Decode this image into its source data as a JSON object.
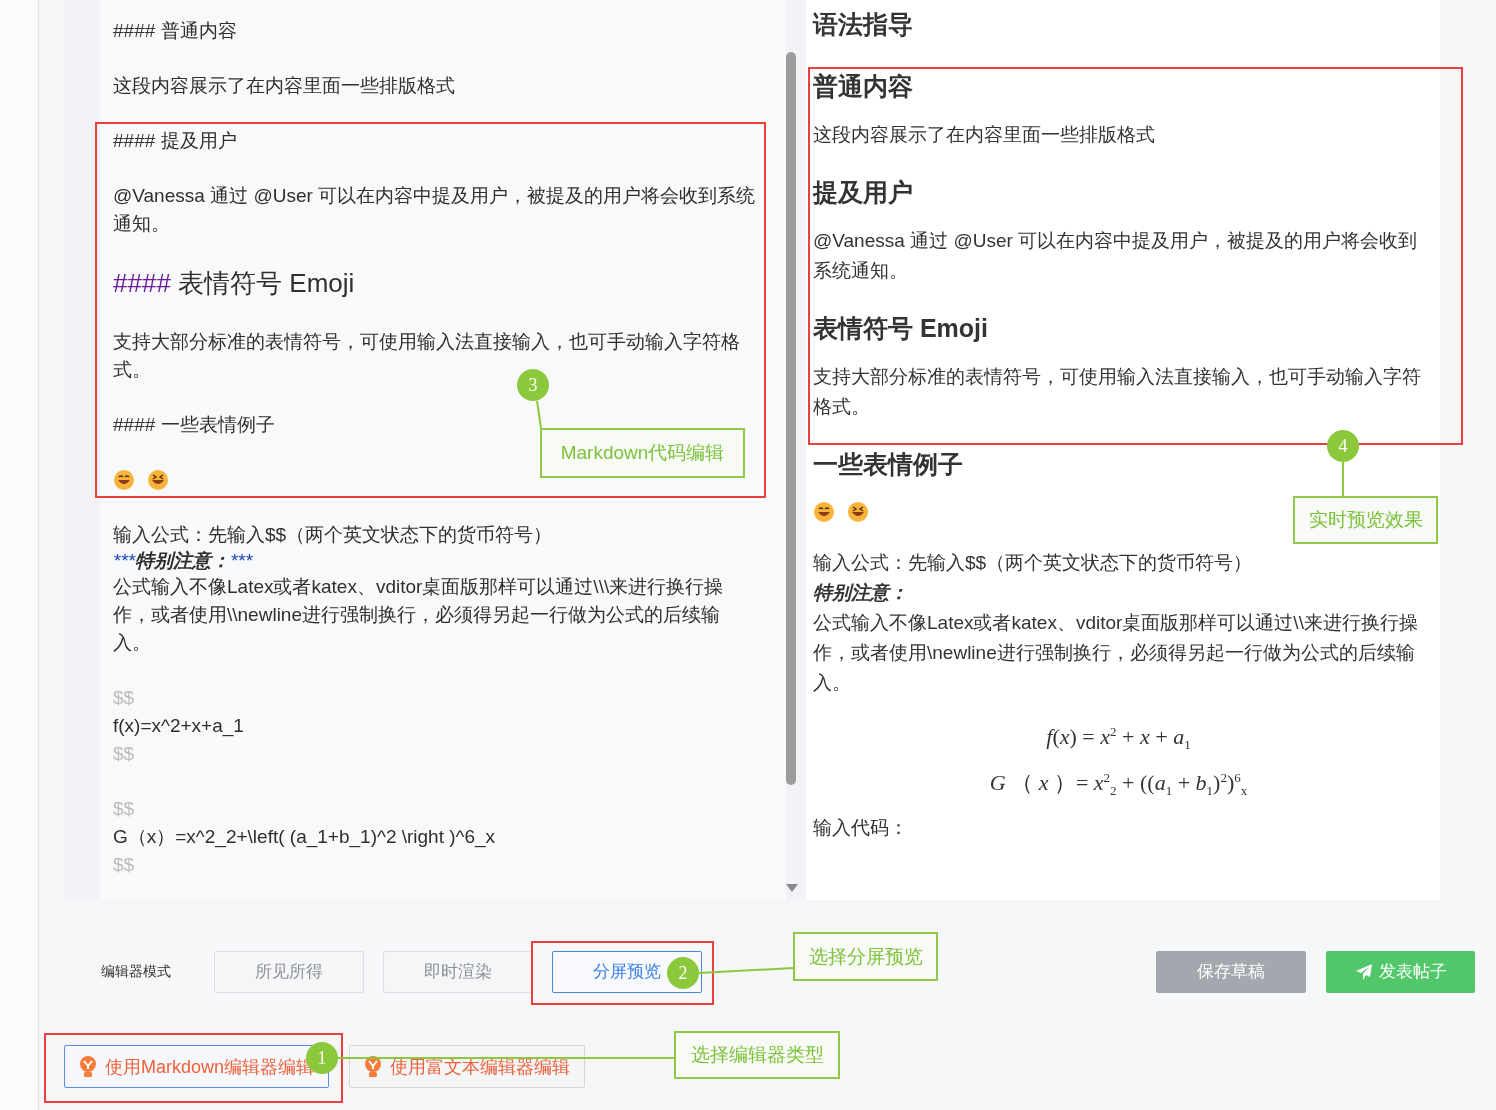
{
  "editor": {
    "lines": [
      {
        "kind": "heading",
        "marker": "####",
        "text": "普通内容"
      },
      {
        "kind": "blank"
      },
      {
        "kind": "text",
        "text": "这段内容展示了在内容里面一些排版格式"
      },
      {
        "kind": "blank"
      },
      {
        "kind": "heading",
        "marker": "####",
        "text": "提及用户"
      },
      {
        "kind": "blank"
      },
      {
        "kind": "text",
        "text": "@Vanessa 通过 @User 可以在内容中提及用户，被提及的用户将会收到系统通知。"
      },
      {
        "kind": "blank"
      },
      {
        "kind": "big-heading",
        "marker": "####",
        "text": "表情符号 Emoji"
      },
      {
        "kind": "blank"
      },
      {
        "kind": "text",
        "text": "支持大部分标准的表情符号，可使用输入法直接输入，也可手动输入字符格式。"
      },
      {
        "kind": "blank"
      },
      {
        "kind": "heading",
        "marker": "####",
        "text": "一些表情例子"
      },
      {
        "kind": "blank"
      },
      {
        "kind": "emoji"
      },
      {
        "kind": "blank"
      },
      {
        "kind": "text",
        "text": "输入公式：先输入$$（两个英文状态下的货币符号）"
      },
      {
        "kind": "note",
        "marker": "***",
        "text": "特别注意：",
        "end": "***"
      },
      {
        "kind": "text",
        "text": "公式输入不像Latex或者katex、vditor桌面版那样可以通过\\\\\\来进行换行操作，或者使用\\\\newline进行强制换行，必须得另起一行做为公式的后续输入。"
      },
      {
        "kind": "blank"
      },
      {
        "kind": "delim",
        "text": "$$"
      },
      {
        "kind": "text",
        "text": "f(x)=x^2+x+a_1"
      },
      {
        "kind": "delim",
        "text": "$$"
      },
      {
        "kind": "blank"
      },
      {
        "kind": "delim",
        "text": "$$"
      },
      {
        "kind": "text",
        "text": "G（x）=x^2_2+\\left( (a_1+b_1)^2  \\right )^6_x"
      },
      {
        "kind": "delim",
        "text": "$$"
      }
    ]
  },
  "preview": {
    "title": "语法指导",
    "blocks": [
      {
        "kind": "heading",
        "text": "普通内容"
      },
      {
        "kind": "text",
        "text": "这段内容展示了在内容里面一些排版格式"
      },
      {
        "kind": "heading",
        "text": "提及用户"
      },
      {
        "kind": "text",
        "text": "@Vanessa 通过 @User 可以在内容中提及用户，被提及的用户将会收到系统通知。"
      },
      {
        "kind": "heading",
        "text": "表情符号 Emoji"
      },
      {
        "kind": "text",
        "text": "支持大部分标准的表情符号，可使用输入法直接输入，也可手动输入字符格式。"
      },
      {
        "kind": "heading",
        "text": "一些表情例子"
      },
      {
        "kind": "emoji"
      },
      {
        "kind": "tight",
        "text": "输入公式：先输入$$（两个英文状态下的货币符号）"
      },
      {
        "kind": "note",
        "text": "特别注意："
      },
      {
        "kind": "text",
        "text": "公式输入不像Latex或者katex、vditor桌面版那样可以通过\\\\来进行换行操作，或者使用\\newline进行强制换行，必须得另起一行做为公式的后续输入。"
      },
      {
        "kind": "math",
        "text": "*f*(*x*) = *x*$^{2}$ + *x* + *a*$_{1}$"
      },
      {
        "kind": "math",
        "text": "*G* （ *x* ）= *x*$^{2}$$_{2}$ + ((*a*$_{1}$ + *b*$_{1}$)$^{2}$)$^{6}$$_{x}$"
      },
      {
        "kind": "text",
        "text": "输入代码："
      }
    ]
  },
  "toolbar": {
    "label": "编辑器模式",
    "modes": [
      {
        "label": "所见所得",
        "selected": false
      },
      {
        "label": "即时渲染",
        "selected": false
      },
      {
        "label": "分屏预览",
        "selected": true
      }
    ],
    "save": "保存草稿",
    "publish": "发表帖子"
  },
  "editor_types": [
    {
      "label": "使用Markdown编辑器编辑",
      "selected": true
    },
    {
      "label": "使用富文本编辑器编辑",
      "selected": false
    }
  ],
  "annotations": [
    {
      "number": "3",
      "label": "Markdown代码编辑"
    },
    {
      "number": "4",
      "label": "实时预览效果"
    },
    {
      "number": "2",
      "label": "选择分屏预览"
    },
    {
      "number": "1",
      "label": "选择编辑器类型"
    }
  ]
}
